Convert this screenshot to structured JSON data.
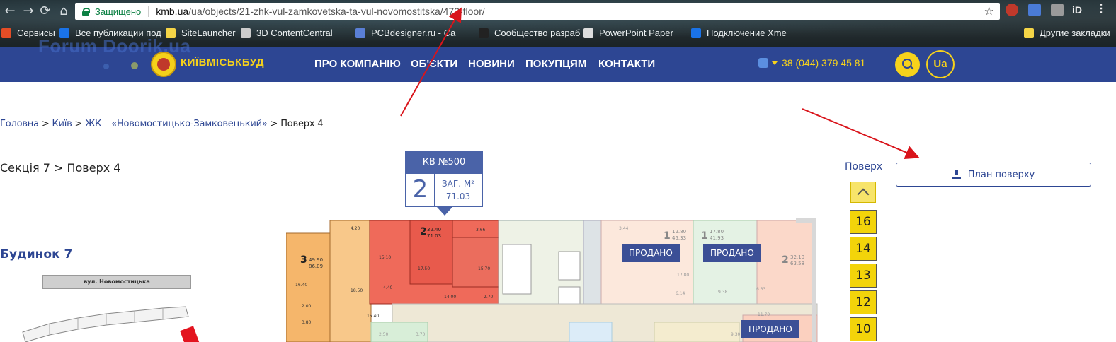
{
  "browser": {
    "secure_label": "Защищено",
    "url_host": "kmb.ua",
    "url_path": "/ua/objects/21-zhk-vul-zamkovetska-ta-vul-novomostitska/473-floor/",
    "bookmarks": [
      {
        "label": "Сервисы",
        "color": "#e44d26"
      },
      {
        "label": "Все публикации под",
        "color": "#1a73e8"
      },
      {
        "label": "SiteLauncher",
        "color": "#f5d547"
      },
      {
        "label": "3D ContentCentral",
        "color": "#cccccc"
      },
      {
        "label": "PCBdesigner.ru - Са",
        "color": "#5a7fd6"
      },
      {
        "label": "Сообщество разраб",
        "color": "#222222"
      },
      {
        "label": "PowerPoint Paper",
        "color": "#dddddd"
      },
      {
        "label": "Подключение Xme",
        "color": "#1a73e8"
      }
    ],
    "other_bookmarks": "Другие закладки"
  },
  "header": {
    "watermark": "Forum Doorik.ua",
    "logo_text": "КИЇВМІСЬКБУД",
    "menu": [
      "ПРО КОМПАНІЮ",
      "ОБ'ЄКТИ",
      "НОВИНИ",
      "ПОКУПЦЯМ",
      "КОНТАКТИ"
    ],
    "phone": "38 (044) 379 45 81",
    "lang": "Ua",
    "colors": {
      "bar": "#2d4693",
      "accent": "#f6d21b"
    }
  },
  "breadcrumb": {
    "home": "Головна",
    "city": "Київ",
    "complex": "ЖК – «Новомостицько-Замковецький»",
    "current": "Поверх 4",
    "sep": ">"
  },
  "section_path": "Секція 7 > Поверх 4",
  "building_title": "Будинок 7",
  "street_label": "вул. Новомостицька",
  "apartment_card": {
    "title": "КВ №500",
    "rooms": "2",
    "area_label": "ЗАГ. М²",
    "area_value": "71.03"
  },
  "floor_nav": {
    "label": "Поверх",
    "floors": [
      "16",
      "14",
      "13",
      "12",
      "10"
    ]
  },
  "plan_button": "План поверху",
  "plan": {
    "sold_label": "ПРОДАНО",
    "units": [
      {
        "rooms": "3",
        "area_a": "49.90",
        "area_b": "86.09"
      },
      {
        "rooms": "2",
        "area_a": "32.40",
        "area_b": "71.03"
      },
      {
        "rooms": "1",
        "area_a": "12.80",
        "area_b": "45.33"
      },
      {
        "rooms": "1",
        "area_a": "17.80",
        "area_b": "41.93"
      },
      {
        "rooms": "2",
        "area_a": "32.10",
        "area_b": "63.58"
      }
    ],
    "room_areas": [
      "4.20",
      "3.66",
      "15.10",
      "17.50",
      "15.70",
      "4.40",
      "18.50",
      "14.00",
      "2.70",
      "16.40",
      "2.00",
      "3.80",
      "15.40",
      "3.44",
      "17.80",
      "6.14",
      "9.38",
      "6.33",
      "11.70",
      "2.50",
      "3.70",
      "9.30"
    ]
  }
}
